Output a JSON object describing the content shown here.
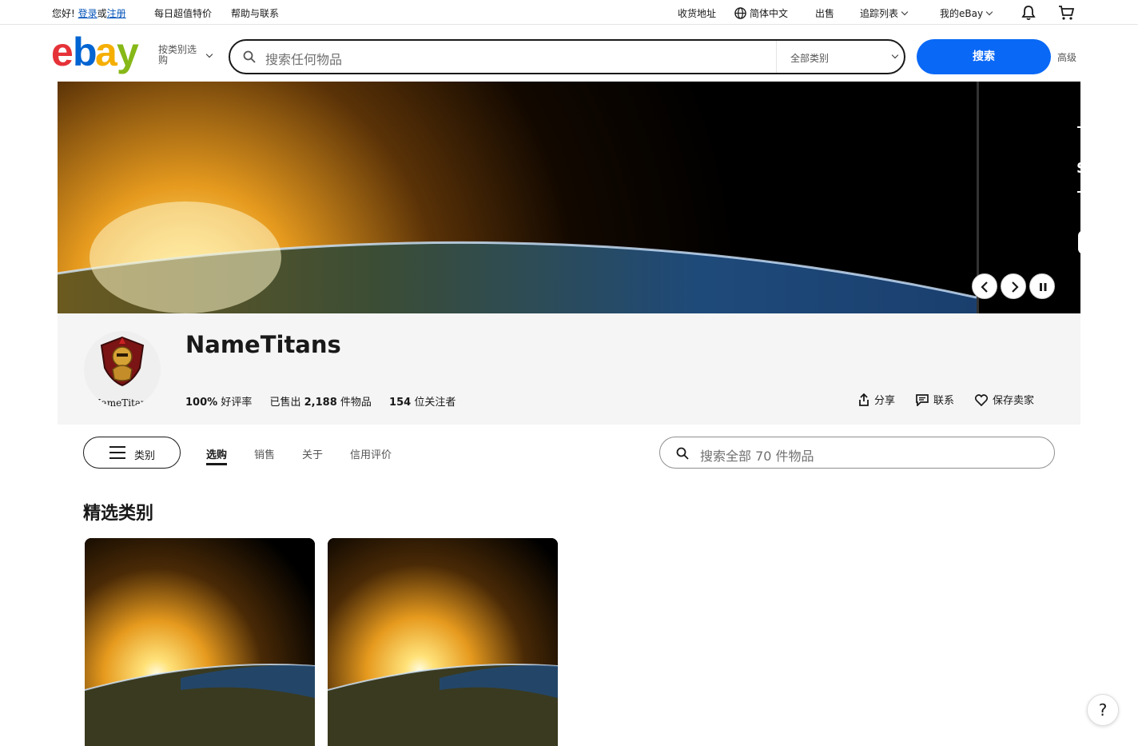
{
  "topbar": {
    "greeting": "您好!",
    "signin": "登录",
    "or": "或",
    "register": "注册",
    "daily_deals": "每日超值特价",
    "help": "帮助与联系",
    "ship_to": "收货地址",
    "language": "简体中文",
    "sell": "出售",
    "watchlist": "追踪列表",
    "my_ebay": "我的eBay"
  },
  "header": {
    "shop_by_category": "按类别选购",
    "search_placeholder": "搜索任何物品",
    "category_select": "全部类别",
    "search_button": "搜索",
    "advanced": "高级"
  },
  "banner": {
    "next_slide_letter": "S"
  },
  "store": {
    "name": "NameTitans",
    "avatar_text": "NameTitans",
    "feedback_value": "100%",
    "feedback_label": "好评率",
    "sold_prefix": "已售出",
    "sold_value": "2,188",
    "sold_suffix": "件物品",
    "followers_value": "154",
    "followers_label": "位关注者",
    "share": "分享",
    "contact": "联系",
    "save_seller": "保存卖家"
  },
  "nav": {
    "categories": "类别",
    "tabs": [
      "选购",
      "销售",
      "关于",
      "信用评价"
    ],
    "store_search_placeholder": "搜索全部 70 件物品"
  },
  "featured": {
    "title": "精选类别"
  },
  "help_button": "?",
  "colors": {
    "brand_blue": "#0968f6",
    "link_blue": "#0654ba",
    "logo_red": "#e53238",
    "logo_blue": "#0064d2",
    "logo_yellow": "#f5af02",
    "logo_green": "#86b817"
  }
}
